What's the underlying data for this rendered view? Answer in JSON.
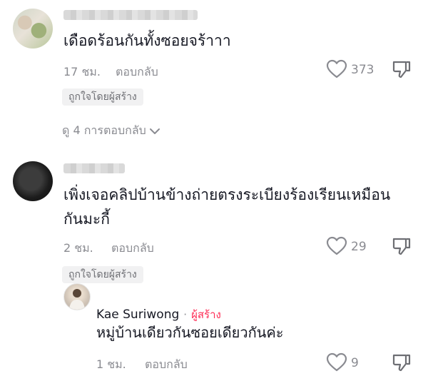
{
  "comments": [
    {
      "text": "เดือดร้อนกันทั้งซอยจร้าาา",
      "time": "17 ชม.",
      "reply_label": "ตอบกลับ",
      "likes": "373",
      "liked_by_creator": "ถูกใจโดยผู้สร้าง",
      "view_replies": "ดู 4 การตอบกลับ"
    },
    {
      "text_line1": "เพิ่งเจอคลิปบ้านข้างถ่ายตรงระเบียงร้องเรียนเหมือน",
      "text_line2": "กันมะกี้",
      "time": "2 ชม.",
      "reply_label": "ตอบกลับ",
      "likes": "29",
      "liked_by_creator": "ถูกใจโดยผู้สร้าง"
    }
  ],
  "creator_reply": {
    "author": "Kae Suriwong",
    "separator": "·",
    "badge": "ผู้สร้าง",
    "text": "หมู่บ้านเดียวกันซอยเดียวกันค่ะ",
    "time": "1 ชม.",
    "reply_label": "ตอบกลับ",
    "likes": "9"
  },
  "icons": {
    "like": "heart-outline-icon",
    "dislike": "thumbs-down-icon",
    "expand": "chevron-down-icon"
  },
  "colors": {
    "text": "#161823",
    "secondary": "#8a8b91",
    "creator_badge": "#fe2c55",
    "liked_pill_bg": "#f1f1f2"
  }
}
